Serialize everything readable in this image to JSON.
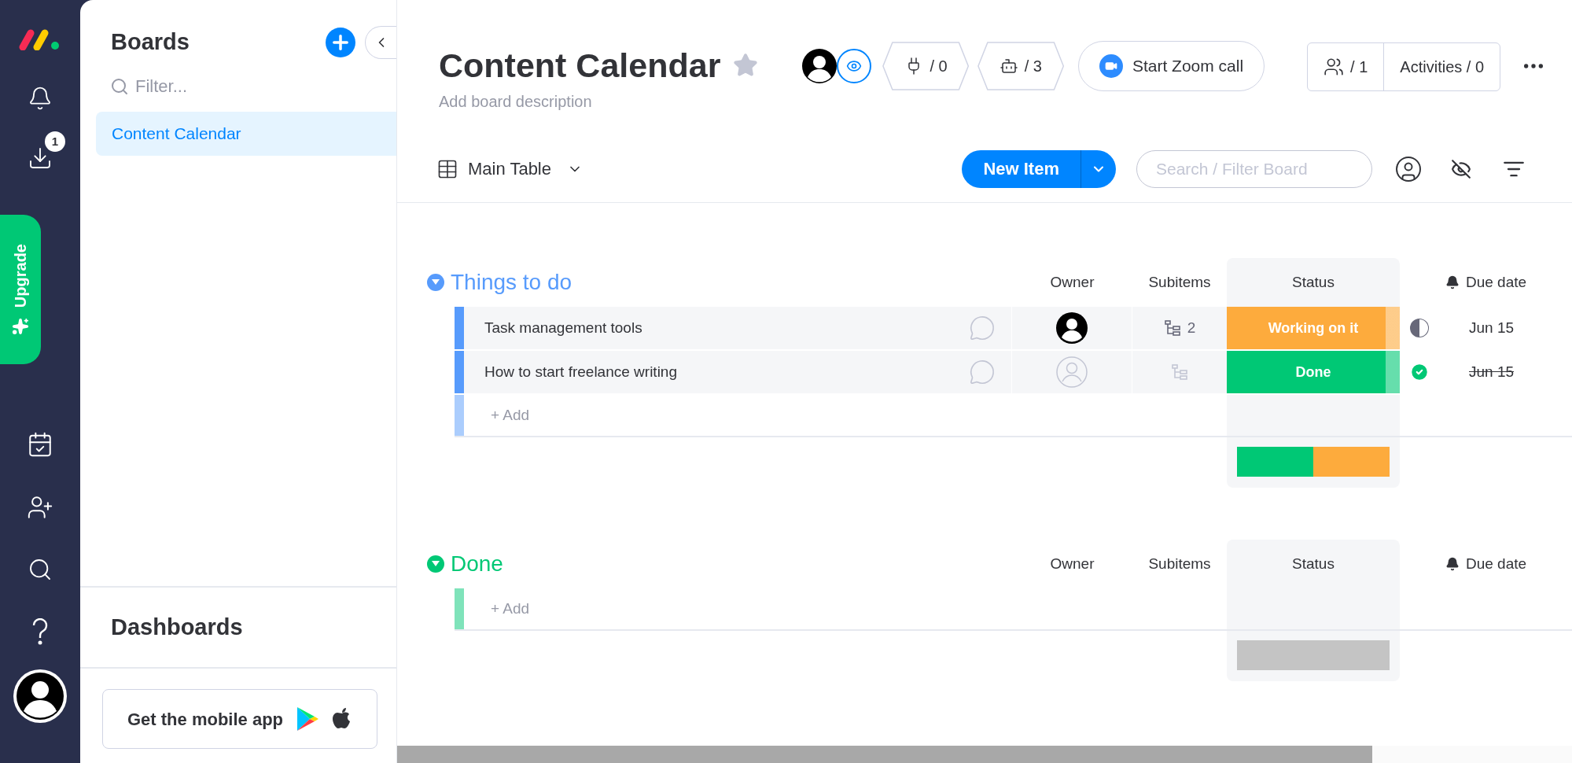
{
  "rail": {
    "inbox_badge": "1",
    "upgrade": "Upgrade"
  },
  "sidebar": {
    "title": "Boards",
    "filter_placeholder": "Filter...",
    "boards": [
      {
        "label": "Content Calendar",
        "selected": true
      }
    ],
    "dashboards_title": "Dashboards",
    "mobile_app": "Get the mobile app"
  },
  "board": {
    "title": "Content Calendar",
    "description_placeholder": "Add board description",
    "integrations": "/ 0",
    "automations": "/ 3",
    "zoom_call": "Start Zoom call",
    "members": "/ 1",
    "activities": "Activities / 0"
  },
  "toolbar": {
    "view": "Main Table",
    "new_item": "New Item",
    "search_placeholder": "Search / Filter Board"
  },
  "groups": [
    {
      "title": "Things to do",
      "color": "#579bfc",
      "expanded": true,
      "columns": [
        "Owner",
        "Subitems",
        "Status",
        "Due date"
      ],
      "rows": [
        {
          "name": "Task management tools",
          "owner_assigned": true,
          "subitems": "2",
          "status": "Working on it",
          "color": "#fdab3d",
          "due": "Jun 15",
          "done": false
        },
        {
          "name": "How to start freelance writing",
          "owner_assigned": false,
          "status": "Done",
          "color": "#00c875",
          "due": "Jun 15",
          "done": true
        }
      ],
      "add_label": "+ Add",
      "summary": [
        {
          "color": "#00c875"
        },
        {
          "color": "#fdab3d"
        }
      ]
    },
    {
      "title": "Done",
      "color": "#00c875",
      "expanded": true,
      "columns": [
        "Owner",
        "Subitems",
        "Status",
        "Due date"
      ],
      "add_label": "+ Add",
      "summary": [
        {
          "color": "#c4c4c4"
        }
      ]
    }
  ]
}
